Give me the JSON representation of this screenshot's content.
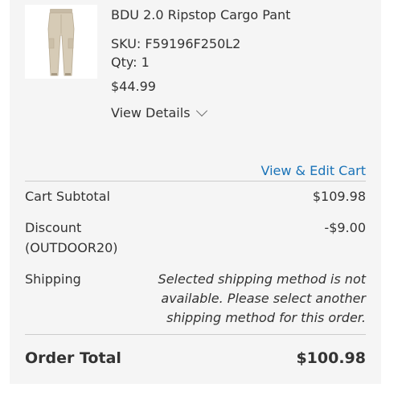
{
  "item": {
    "name": "BDU 2.0 Ripstop Cargo Pant",
    "sku": "SKU: F59196F250L2",
    "qty": "Qty: 1",
    "price": "$44.99",
    "view_details": "View Details",
    "image_icon": "cargo-pant-product-image"
  },
  "links": {
    "view_edit_cart": "View & Edit Cart"
  },
  "totals": {
    "subtotal_label": "Cart Subtotal",
    "subtotal_value": "$109.98",
    "discount_label_line1": "Discount",
    "discount_label_line2": "(OUTDOOR20)",
    "discount_value": "-$9.00",
    "shipping_label": "Shipping",
    "shipping_message": "Selected shipping method is not available. Please select another shipping method for this order.",
    "order_total_label": "Order Total",
    "order_total_value": "$100.98"
  },
  "colors": {
    "link": "#1a73b8",
    "panel_background": "#f5f5f5"
  }
}
